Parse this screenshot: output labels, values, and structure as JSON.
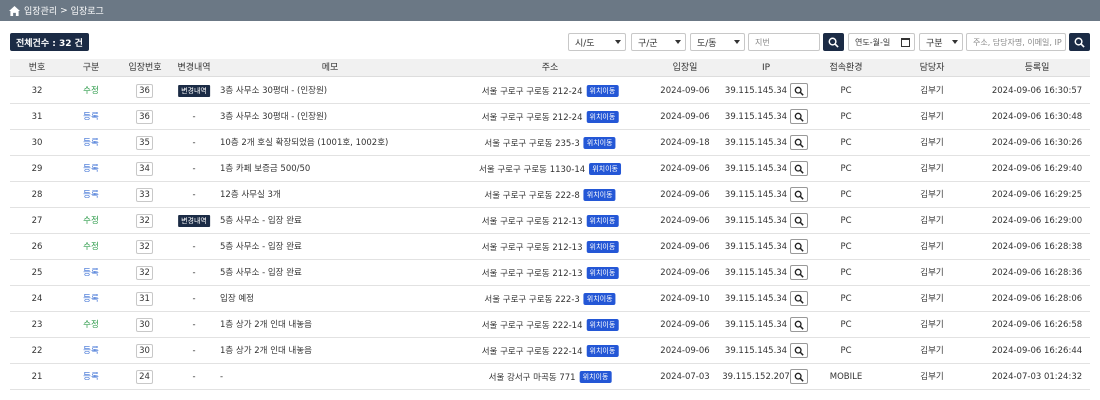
{
  "breadcrumb": {
    "root": "입장관리",
    "separator": ">",
    "current": "입장로그"
  },
  "total_label": "전체건수 : 32 건",
  "filters": {
    "city": "시/도",
    "district": "구/군",
    "town": "도/동",
    "lot_placeholder": "지번",
    "date_placeholder": "연도-월-일",
    "category": "구분",
    "keyword_placeholder": "주소, 담당자명, 이메일, IP"
  },
  "columns": [
    "번호",
    "구분",
    "입장번호",
    "변경내역",
    "메모",
    "주소",
    "입장일",
    "IP",
    "접속환경",
    "담당자",
    "등록일"
  ],
  "location_label": "위치이동",
  "change_label": "변경내역",
  "rows": [
    {
      "no": "32",
      "type": "수정",
      "type_color": "green",
      "entry": "36",
      "change": true,
      "memo": "3층 사무소 30평대 - (인장원)",
      "addr": "서울 구로구 구로동 212-24",
      "date": "2024-09-06",
      "ip": "39.115.145.34",
      "env": "PC",
      "manager": "김부기",
      "reg": "2024-09-06 16:30:57"
    },
    {
      "no": "31",
      "type": "등록",
      "type_color": "blue",
      "entry": "36",
      "change": false,
      "memo": "3층 사무소 30평대 - (인장원)",
      "addr": "서울 구로구 구로동 212-24",
      "date": "2024-09-06",
      "ip": "39.115.145.34",
      "env": "PC",
      "manager": "김부기",
      "reg": "2024-09-06 16:30:48"
    },
    {
      "no": "30",
      "type": "등록",
      "type_color": "blue",
      "entry": "35",
      "change": false,
      "memo": "10층 2개 호실 확장되었음 (1001호, 1002호)",
      "addr": "서울 구로구 구로동 235-3",
      "date": "2024-09-18",
      "ip": "39.115.145.34",
      "env": "PC",
      "manager": "김부기",
      "reg": "2024-09-06 16:30:26"
    },
    {
      "no": "29",
      "type": "등록",
      "type_color": "blue",
      "entry": "34",
      "change": false,
      "memo": "1층 카페 보증금 500/50",
      "addr": "서울 구로구 구로동 1130-14",
      "date": "2024-09-06",
      "ip": "39.115.145.34",
      "env": "PC",
      "manager": "김부기",
      "reg": "2024-09-06 16:29:40"
    },
    {
      "no": "28",
      "type": "등록",
      "type_color": "blue",
      "entry": "33",
      "change": false,
      "memo": "12층 사무실 3개",
      "addr": "서울 구로구 구로동 222-8",
      "date": "2024-09-06",
      "ip": "39.115.145.34",
      "env": "PC",
      "manager": "김부기",
      "reg": "2024-09-06 16:29:25"
    },
    {
      "no": "27",
      "type": "수정",
      "type_color": "green",
      "entry": "32",
      "change": true,
      "memo": "5층 사무소 - 입장 완료",
      "addr": "서울 구로구 구로동 212-13",
      "date": "2024-09-06",
      "ip": "39.115.145.34",
      "env": "PC",
      "manager": "김부기",
      "reg": "2024-09-06 16:29:00"
    },
    {
      "no": "26",
      "type": "수정",
      "type_color": "green",
      "entry": "32",
      "change": false,
      "memo": "5층 사무소 - 입장 완료",
      "addr": "서울 구로구 구로동 212-13",
      "date": "2024-09-06",
      "ip": "39.115.145.34",
      "env": "PC",
      "manager": "김부기",
      "reg": "2024-09-06 16:28:38"
    },
    {
      "no": "25",
      "type": "등록",
      "type_color": "blue",
      "entry": "32",
      "change": false,
      "memo": "5층 사무소 - 입장 완료",
      "addr": "서울 구로구 구로동 212-13",
      "date": "2024-09-06",
      "ip": "39.115.145.34",
      "env": "PC",
      "manager": "김부기",
      "reg": "2024-09-06 16:28:36"
    },
    {
      "no": "24",
      "type": "등록",
      "type_color": "blue",
      "entry": "31",
      "change": false,
      "memo": "입장 예정",
      "addr": "서울 구로구 구로동 222-3",
      "date": "2024-09-10",
      "ip": "39.115.145.34",
      "env": "PC",
      "manager": "김부기",
      "reg": "2024-09-06 16:28:06"
    },
    {
      "no": "23",
      "type": "수정",
      "type_color": "green",
      "entry": "30",
      "change": false,
      "memo": "1층 상가 2개 인대 내놓음",
      "addr": "서울 구로구 구로동 222-14",
      "date": "2024-09-06",
      "ip": "39.115.145.34",
      "env": "PC",
      "manager": "김부기",
      "reg": "2024-09-06 16:26:58"
    },
    {
      "no": "22",
      "type": "등록",
      "type_color": "blue",
      "entry": "30",
      "change": false,
      "memo": "1층 상가 2개 인대 내놓음",
      "addr": "서울 구로구 구로동 222-14",
      "date": "2024-09-06",
      "ip": "39.115.145.34",
      "env": "PC",
      "manager": "김부기",
      "reg": "2024-09-06 16:26:44"
    },
    {
      "no": "21",
      "type": "등록",
      "type_color": "blue",
      "entry": "24",
      "change": false,
      "memo": "-",
      "addr": "서울 강서구 마곡동 771",
      "date": "2024-07-03",
      "ip": "39.115.152.207",
      "env": "MOBILE",
      "manager": "김부기",
      "reg": "2024-07-03 01:24:32"
    }
  ],
  "colors": {
    "navy": "#1b2b45",
    "topbar": "#6b7885",
    "location": "#2457d6",
    "edit": "#2d9b4a",
    "register": "#3b6fd4"
  }
}
